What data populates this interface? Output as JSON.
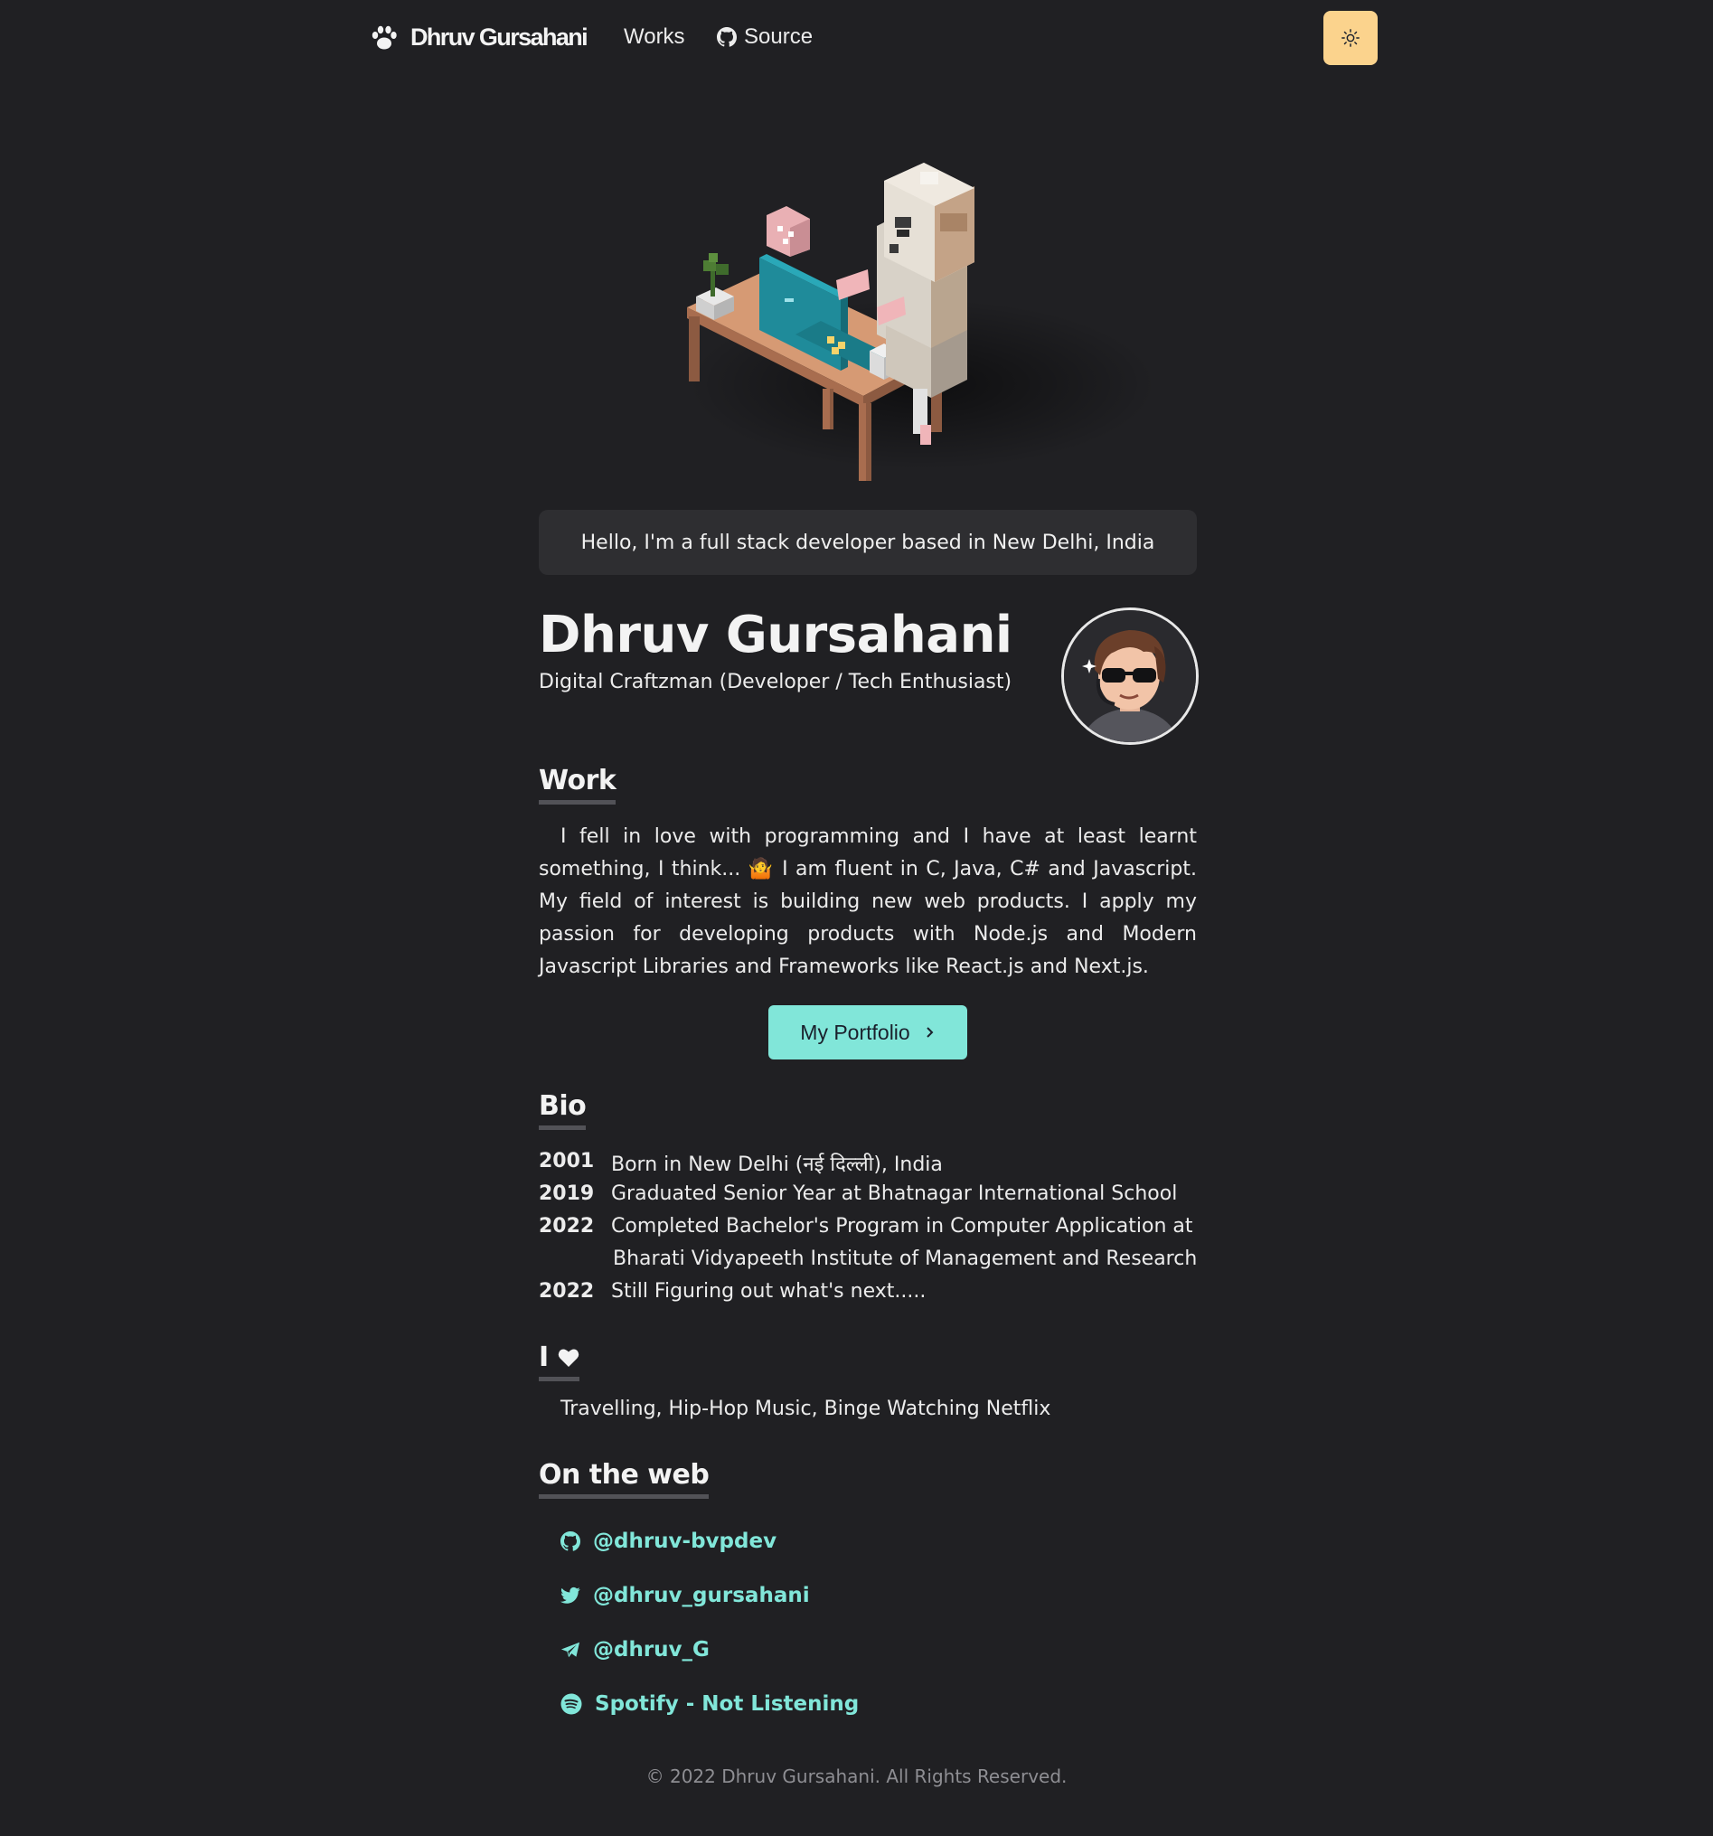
{
  "nav": {
    "brand": "Dhruv Gursahani",
    "links": [
      {
        "label": "Works"
      },
      {
        "label": "Source"
      }
    ]
  },
  "hero": {
    "greeting": "Hello, I'm a full stack developer based in New Delhi, India"
  },
  "profile": {
    "name": "Dhruv Gursahani",
    "title": "Digital Craftzman (Developer / Tech Enthusiast)"
  },
  "work": {
    "heading": "Work",
    "text": "I fell in love with programming and I have at least learnt something, I think... 🤷 I am fluent in C, Java, C# and Javascript. My field of interest is building new web products. I apply my passion for developing products with Node.js and Modern Javascript Libraries and Frameworks like React.js and Next.js.",
    "button": "My Portfolio"
  },
  "bio": {
    "heading": "Bio",
    "entries": [
      {
        "year": "2001",
        "text": "Born in New Delhi (नई दिल्ली), India"
      },
      {
        "year": "2019",
        "text": "Graduated Senior Year at Bhatnagar International School"
      },
      {
        "year": "2022",
        "text": "Completed Bachelor's Program in Computer Application at",
        "cont": "Bharati Vidyapeeth Institute of Management and Research"
      },
      {
        "year": "2022",
        "text": "Still Figuring out what's next....."
      }
    ]
  },
  "love": {
    "heading": "I",
    "text": "Travelling, Hip-Hop Music, Binge Watching Netflix"
  },
  "web": {
    "heading": "On the web",
    "links": [
      {
        "label": "@dhruv-bvpdev",
        "icon": "github-icon"
      },
      {
        "label": "@dhruv_gursahani",
        "icon": "twitter-icon"
      },
      {
        "label": "@dhruv_G",
        "icon": "telegram-icon"
      },
      {
        "label": "Spotify - Not Listening",
        "icon": "spotify-icon"
      }
    ]
  },
  "footer": {
    "text": "© 2022 Dhruv Gursahani. All Rights Reserved."
  },
  "colors": {
    "background": "#202023",
    "accent": "#81e6d9",
    "theme_button": "#fbd38d"
  }
}
